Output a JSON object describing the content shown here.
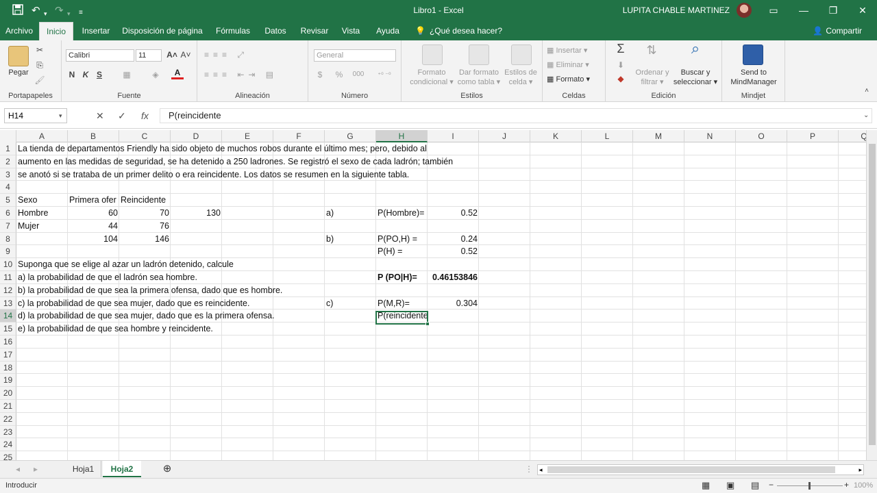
{
  "window": {
    "title": "Libro1  -  Excel",
    "user": "LUPITA CHABLE MARTINEZ",
    "qat": {
      "save_icon": "save-icon",
      "undo_icon": "undo-icon",
      "redo_icon": "redo-icon"
    }
  },
  "tabs": [
    "Archivo",
    "Inicio",
    "Insertar",
    "Disposición de página",
    "Fórmulas",
    "Datos",
    "Revisar",
    "Vista",
    "Ayuda"
  ],
  "active_tab": "Inicio",
  "tell_me": "¿Qué desea hacer?",
  "share": "Compartir",
  "ribbon": {
    "portapapeles": {
      "name": "Portapapeles",
      "paste": "Pegar"
    },
    "fuente": {
      "name": "Fuente",
      "font": "Calibri",
      "size": "11",
      "bold": "N",
      "italic": "K",
      "underline": "S"
    },
    "alineacion": {
      "name": "Alineación"
    },
    "numero": {
      "name": "Número",
      "format": "General",
      "currency": "$",
      "percent": "%",
      "thousands": "000"
    },
    "estilos": {
      "name": "Estilos",
      "cond1": "Formato",
      "cond2": "condicional",
      "table1": "Dar formato",
      "table2": "como tabla",
      "cell1": "Estilos de",
      "cell2": "celda"
    },
    "celdas": {
      "name": "Celdas",
      "insert": "Insertar",
      "delete": "Eliminar",
      "format": "Formato"
    },
    "edicion": {
      "name": "Edición",
      "sort1": "Ordenar y",
      "sort2": "filtrar",
      "find1": "Buscar y",
      "find2": "seleccionar"
    },
    "mindjet": {
      "name": "Mindjet",
      "send1": "Send to",
      "send2": "MindManager"
    }
  },
  "formula_bar": {
    "name_box": "H14",
    "content": "P(reincidente"
  },
  "columns": [
    "A",
    "B",
    "C",
    "D",
    "E",
    "F",
    "G",
    "H",
    "I",
    "J",
    "K",
    "L",
    "M",
    "N",
    "O",
    "P",
    "Q"
  ],
  "rows": [
    "1",
    "2",
    "3",
    "4",
    "5",
    "6",
    "7",
    "8",
    "9",
    "10",
    "11",
    "12",
    "13",
    "14",
    "15",
    "16",
    "17",
    "18",
    "19",
    "20",
    "21",
    "22",
    "23",
    "24",
    "25"
  ],
  "selected_cell": {
    "column": "H",
    "row": "14"
  },
  "cells": {
    "A1": "La tienda de departamentos Friendly ha sido objeto de muchos robos durante el último mes; pero, debido al",
    "A2": "aumento en las medidas de seguridad, se ha detenido a 250 ladrones. Se registró el sexo de cada ladrón; también",
    "A3": "se anotó si se trataba de un primer delito o era reincidente. Los datos se resumen en la siguiente tabla.",
    "A5": "Sexo",
    "B5": "Primera ofer",
    "C5": "Reincidente",
    "A6": "Hombre",
    "B6": "60",
    "C6": "70",
    "D6": "130",
    "G6": "a)",
    "H6": "P(Hombre)=",
    "I6": "0.52",
    "A7": "Mujer",
    "B7": "44",
    "C7": "76",
    "B8": "104",
    "C8": "146",
    "G8": "b)",
    "H8": "P(PO,H) =",
    "I8": "0.24",
    "H9": "P(H) =",
    "I9": "0.52",
    "A10": "Suponga que se elige al azar un ladrón detenido, calcule",
    "A11": "a) la probabilidad de que el ladrón sea hombre.",
    "H11": "P (PO|H)=",
    "I11": "0.46153846",
    "A12": "b) la probabilidad de que sea la primera ofensa, dado que es hombre.",
    "A13": "c) la probabilidad de que sea mujer, dado que es reincidente.",
    "G13": "c)",
    "H13": "P(M,R)=",
    "I13": "0.304",
    "A14": "d) la probabilidad de que sea mujer, dado que es la primera ofensa.",
    "H14": "P(reincidente",
    "A15": "e) la probabilidad de que sea hombre y reincidente."
  },
  "sheets": [
    "Hoja1",
    "Hoja2"
  ],
  "active_sheet": "Hoja2",
  "status": {
    "mode": "Introducir",
    "zoom": "100%"
  }
}
